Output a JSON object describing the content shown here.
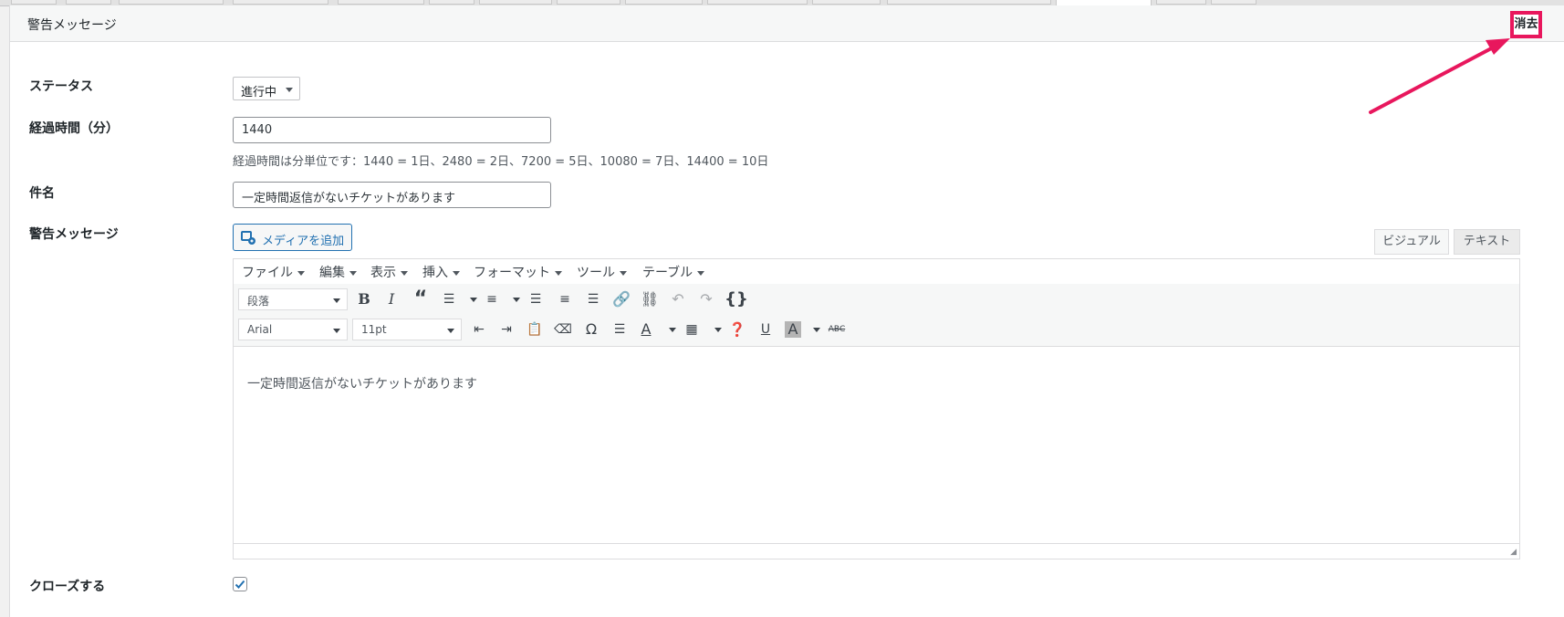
{
  "panel": {
    "title": "警告メッセージ",
    "delete_label": "消去"
  },
  "fields": {
    "status": {
      "label": "ステータス",
      "value": "進行中"
    },
    "elapsed": {
      "label": "経過時間（分）",
      "value": "1440",
      "help": "経過時間は分単位です：1440 = 1日、2480 = 2日、7200 = 5日、10080 = 7日、14400 = 10日"
    },
    "subject": {
      "label": "件名",
      "value": "一定時間返信がないチケットがあります"
    },
    "message": {
      "label": "警告メッセージ"
    },
    "close": {
      "label": "クローズする",
      "checked": true
    }
  },
  "editor": {
    "add_media": "メディアを追加",
    "tabs": {
      "visual": "ビジュアル",
      "text": "テキスト"
    },
    "menus": [
      "ファイル",
      "編集",
      "表示",
      "挿入",
      "フォーマット",
      "ツール",
      "テーブル"
    ],
    "format_select": "段落",
    "font_select": "Arial",
    "size_select": "11pt",
    "content": "一定時間返信がないチケットがあります",
    "accent_color": "#e8175d",
    "link_color": "#2271b1"
  }
}
